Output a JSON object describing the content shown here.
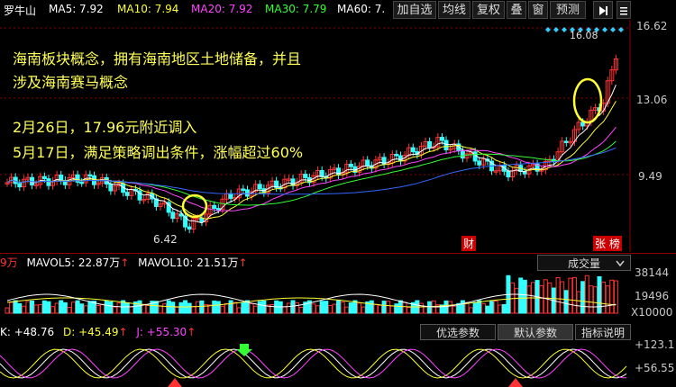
{
  "stock": {
    "name": "罗牛山",
    "ma5": "MA5: 7.92",
    "ma10": "MA10: 7.94",
    "ma20": "MA20: 7.92",
    "ma30": "MA30: 7.79",
    "ma60": "MA60: 7."
  },
  "toolbar": [
    "加自选",
    "均线",
    "复权",
    "叠",
    "窗",
    "预测"
  ],
  "toolbar_icons": [
    "arrow-right-icon",
    "menu-icon"
  ],
  "price_axis": [
    "16.62",
    "13.06",
    "9.49"
  ],
  "chart_labels": {
    "high": "16.08",
    "low": "6.42",
    "cai": "财",
    "zhangting": "张 榜"
  },
  "annotations": {
    "line1": "海南板块概念，拥有海南地区土地储备，并且",
    "line2": "涉及海南赛马概念",
    "line3": "2月26日，17.96元附近调入",
    "line4": "5月17日，满足策略调出条件，涨幅超过60%"
  },
  "volume": {
    "vol": "9万",
    "mavol5": "MAVOL5: 22.87万",
    "mavol10": "MAVOL10: 21.51万",
    "dropdown": "成交量",
    "axis": [
      "38144",
      "19496",
      "X10000"
    ],
    "buttons": [
      "优选参数",
      "默认参数",
      "指标说明"
    ]
  },
  "kdj": {
    "k": "K: +48.76",
    "d": "D: +45.49",
    "j": "J: +55.30",
    "axis": [
      "+123.1",
      "+56.55"
    ]
  },
  "colors": {
    "up": "#ff3333",
    "down": "#33ffff",
    "ma5": "#ffffff",
    "ma10": "#ffff33",
    "ma20": "#ff44ff",
    "ma30": "#33ff33",
    "ma60": "#ffffff",
    "annotation": "#ffff55",
    "grid": "#8b0000"
  }
}
